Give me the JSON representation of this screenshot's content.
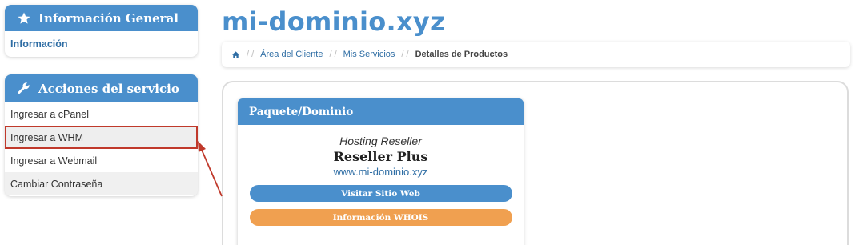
{
  "sidebar": {
    "general_panel": {
      "title": "Información General",
      "link": "Información"
    },
    "actions_panel": {
      "title": "Acciones del servicio",
      "items": [
        {
          "label": "Ingresar a cPanel"
        },
        {
          "label": "Ingresar a WHM"
        },
        {
          "label": "Ingresar a Webmail"
        },
        {
          "label": "Cambiar Contraseña"
        }
      ]
    }
  },
  "header": {
    "domain": "mi-dominio.xyz"
  },
  "breadcrumb": {
    "items": [
      "Área del Cliente",
      "Mis Servicios"
    ],
    "separator": "/ /",
    "current": "Detalles de Productos"
  },
  "package_card": {
    "title": "Paquete/Dominio",
    "hosting_type": "Hosting Reseller",
    "plan_name": "Reseller Plus",
    "domain_link": "www.mi-dominio.xyz",
    "visit_button": "Visitar Sitio Web",
    "whois_button": "Información WHOIS"
  },
  "colors": {
    "primary": "#4a8fcc",
    "link": "#2e6da4",
    "whois": "#f0a050",
    "annotation": "#c0392b"
  },
  "icons": {
    "general_panel": "star-icon",
    "actions_panel": "wrench-icon",
    "breadcrumb_home": "home-icon"
  }
}
